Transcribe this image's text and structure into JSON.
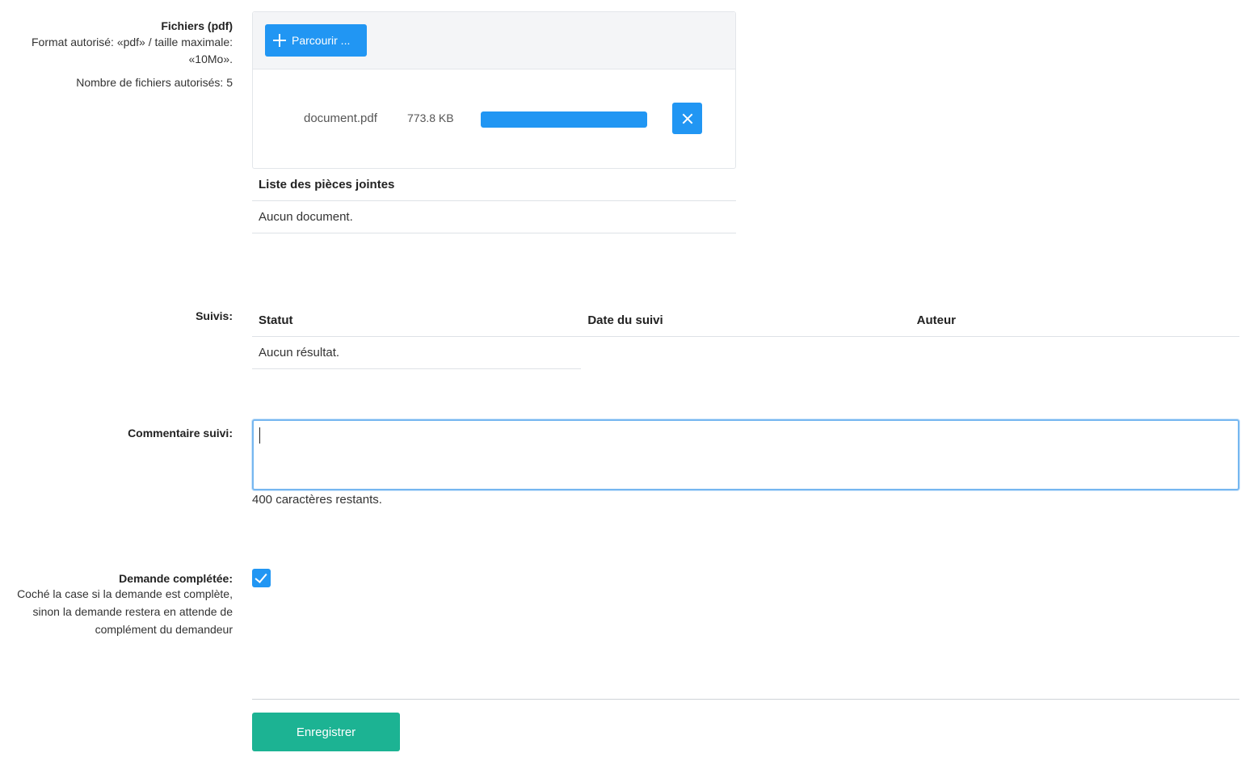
{
  "files": {
    "label": "Fichiers (pdf)",
    "help_line1": "Format autorisé: «pdf» / taille maximale:",
    "help_line2": "«10Mo».",
    "count_help": "Nombre de fichiers autorisés: 5",
    "browse_label": "Parcourir ...",
    "upload": {
      "file_name": "document.pdf",
      "file_size": "773.8 KB",
      "progress_percent": 100
    },
    "colors": {
      "accent": "#2196f3"
    }
  },
  "attachments": {
    "header": "Liste des pièces jointes",
    "empty_text": "Aucun document."
  },
  "suivis": {
    "label": "Suivis:",
    "columns": [
      "Statut",
      "Date du suivi",
      "Auteur"
    ],
    "empty_text": "Aucun résultat."
  },
  "comment": {
    "label": "Commentaire suivi:",
    "value": "",
    "remaining": "400 caractères restants."
  },
  "completed": {
    "label": "Demande complétée:",
    "help_line1": "Coché la case si la demande est complète,",
    "help_line2": "sinon la demande restera en attende de",
    "help_line3": "complément du demandeur",
    "checked": true
  },
  "save_label": "Enregistrer",
  "save_color": "#1cb393",
  "icons": {
    "browse": "plus-icon",
    "remove": "close-icon",
    "checkbox": "check-icon"
  }
}
